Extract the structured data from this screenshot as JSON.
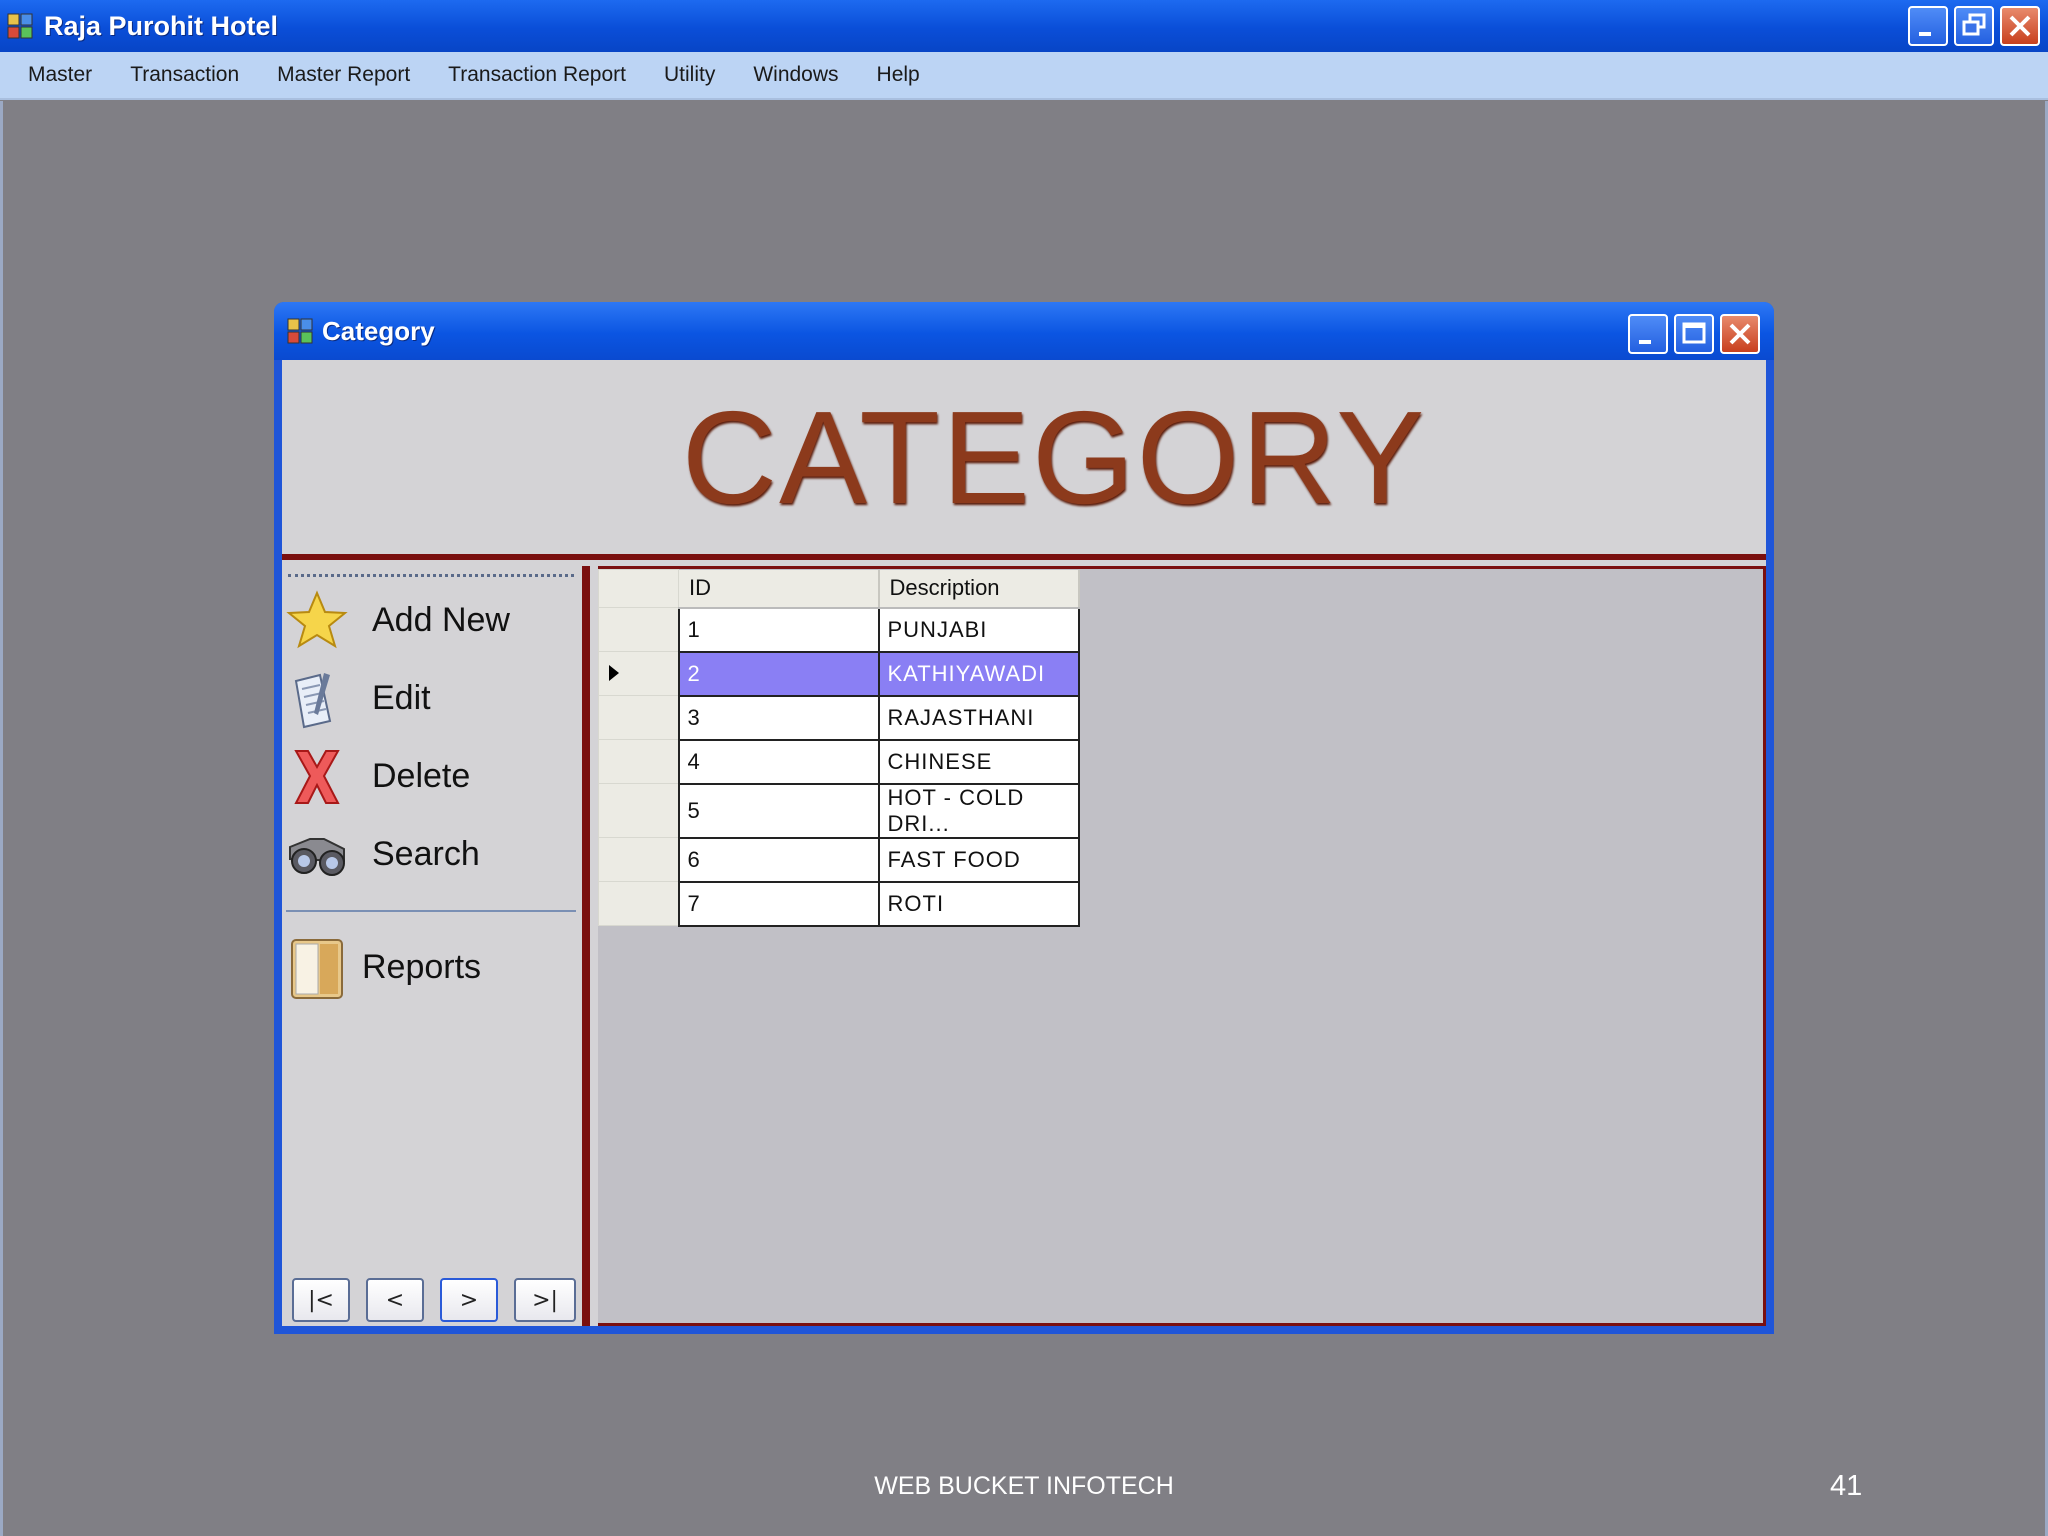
{
  "app": {
    "title": "Raja Purohit Hotel"
  },
  "menu": {
    "items": [
      "Master",
      "Transaction",
      "Master Report",
      "Transaction Report",
      "Utility",
      "Windows",
      "Help"
    ]
  },
  "child_window": {
    "title": "Category",
    "banner": "CATEGORY"
  },
  "sidebar": {
    "add_new": "Add New",
    "edit": "Edit",
    "delete": "Delete",
    "search": "Search",
    "reports": "Reports",
    "nav": {
      "first": "|<",
      "prev": "<",
      "next": ">",
      "last": ">|"
    }
  },
  "grid": {
    "columns": [
      "ID",
      "Description"
    ],
    "selected_row": 2,
    "rows": [
      {
        "id": "1",
        "description": "PUNJABI"
      },
      {
        "id": "2",
        "description": "KATHIYAWADI"
      },
      {
        "id": "3",
        "description": "RAJASTHANI"
      },
      {
        "id": "4",
        "description": "CHINESE"
      },
      {
        "id": "5",
        "description": "HOT - COLD DRI..."
      },
      {
        "id": "6",
        "description": "FAST FOOD"
      },
      {
        "id": "7",
        "description": "ROTI"
      }
    ]
  },
  "footer": {
    "text": "WEB BUCKET INFOTECH",
    "page_number": "41"
  },
  "colors": {
    "titlebar": "#0a4ed8",
    "banner_text": "#8c3a1c",
    "frame_red": "#7a0f0f",
    "selection": "#8a7ff4"
  }
}
